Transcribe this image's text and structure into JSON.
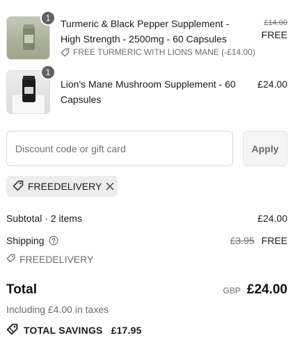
{
  "line_items": [
    {
      "quantity": "1",
      "title": "Turmeric & Black Pepper Supplement - High Strength - 2500mg - 60 Capsules",
      "original_price": "£14.00",
      "price": "FREE",
      "discount": "FREE TURMERIC WITH LIONS MANE (-£14.00)",
      "icons": {
        "tag": "tag-icon"
      }
    },
    {
      "quantity": "1",
      "title": "Lion's Mane Mushroom Supplement - 60 Capsules",
      "price": "£24.00"
    }
  ],
  "discount_form": {
    "placeholder": "Discount code or gift card",
    "value": "",
    "apply_label": "Apply"
  },
  "applied_code": {
    "code": "FREEDELIVERY",
    "icons": {
      "tag": "tag-icon",
      "remove": "close-icon"
    }
  },
  "summary": {
    "subtotal_label": "Subtotal · 2 items",
    "subtotal_value": "£24.00",
    "shipping_label": "Shipping",
    "shipping_original": "£3.95",
    "shipping_value": "FREE",
    "shipping_code": "FREEDELIVERY",
    "total_label": "Total",
    "currency": "GBP",
    "total_value": "£24.00",
    "taxes_note": "Including £4.00 in taxes",
    "savings_label": "TOTAL SAVINGS",
    "savings_value": "£17.95"
  },
  "colors": {
    "badge": "#616161",
    "muted_text": "#6b6b6b",
    "chip_background": "#ededed",
    "apply_background": "#f5f5f5"
  }
}
